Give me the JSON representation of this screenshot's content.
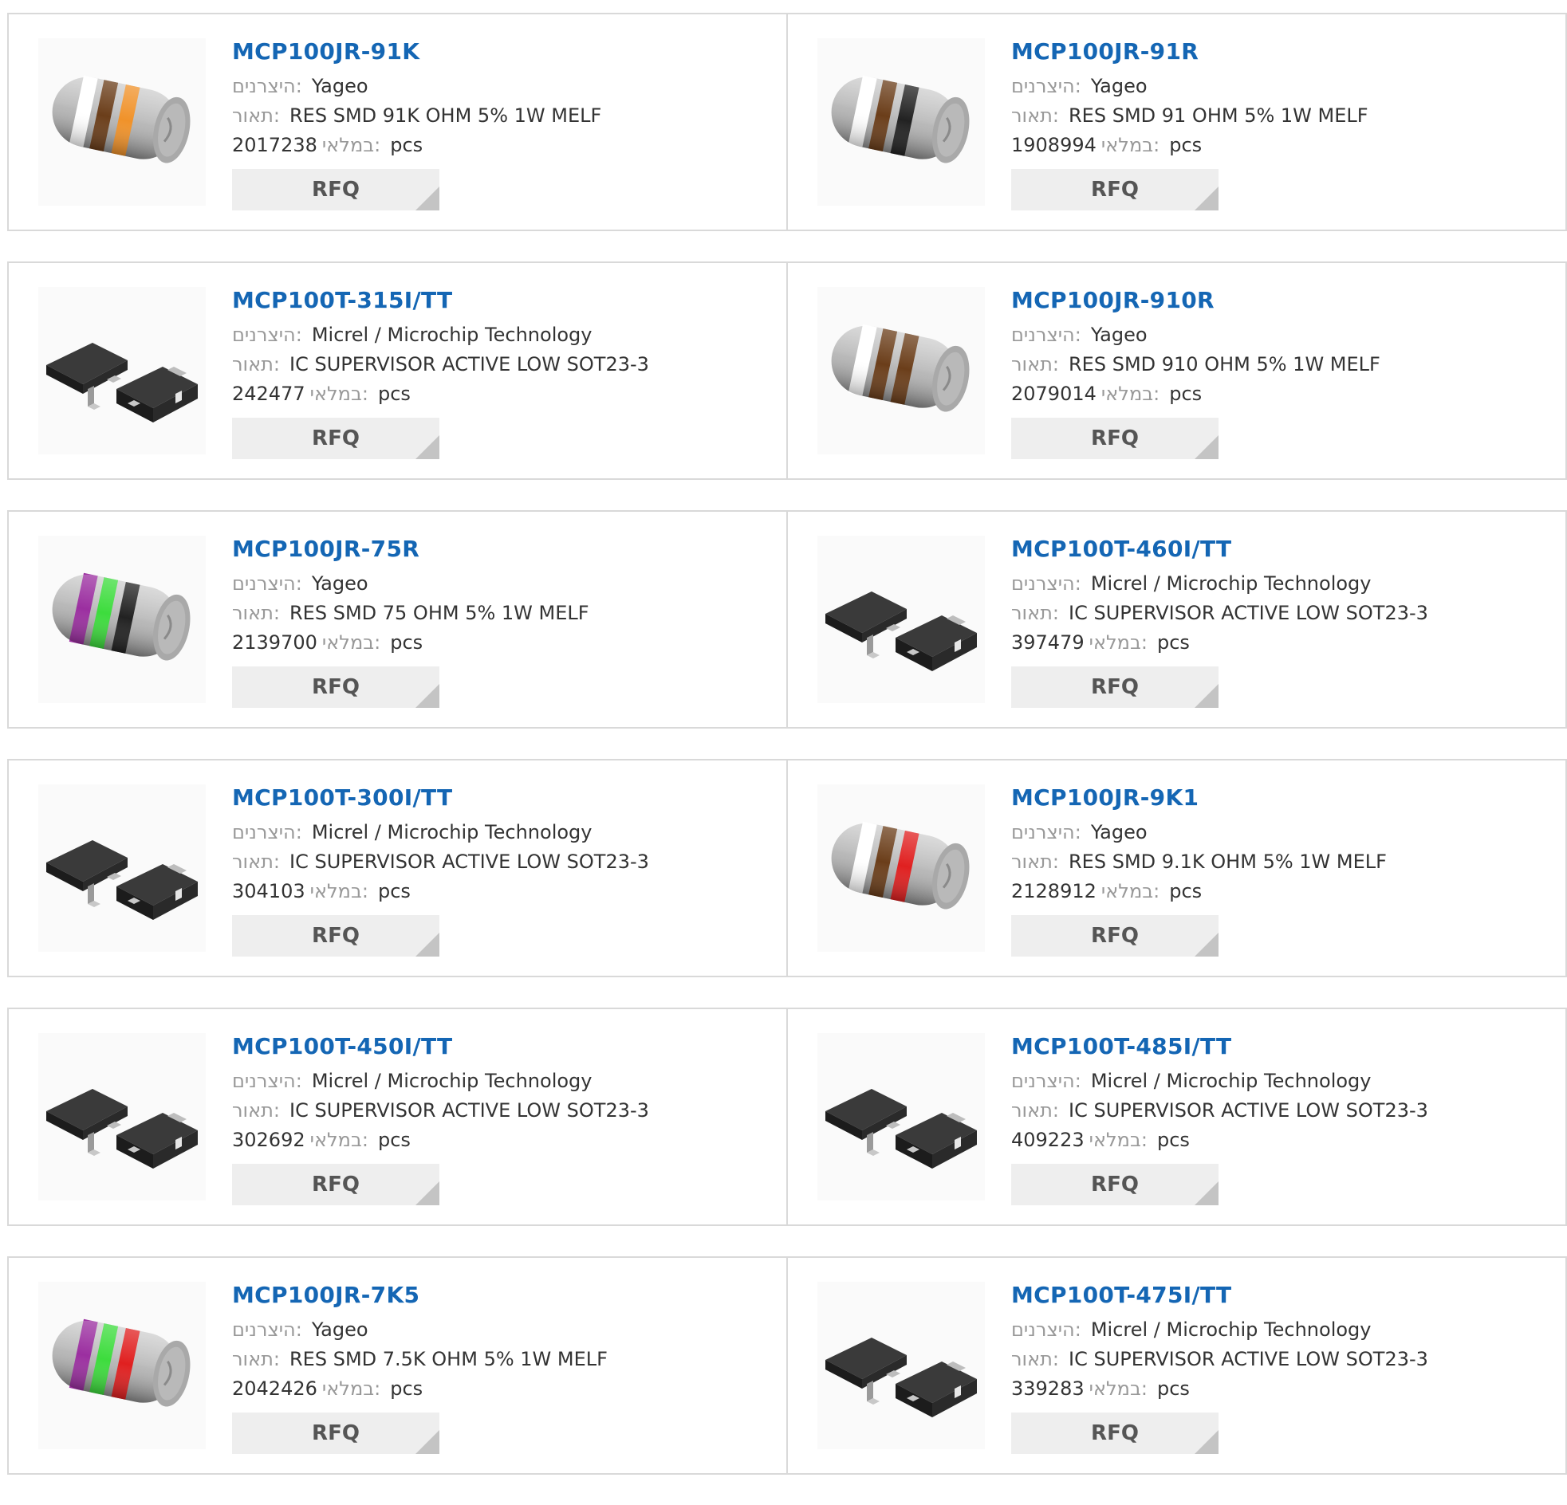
{
  "labels": {
    "manufacturer": "היצרנים:",
    "description": "תאור:",
    "stock": "במלאי:",
    "unit": "pcs",
    "rfq": "RFQ"
  },
  "rows": [
    [
      {
        "part": "MCP100JR-91K",
        "manufacturer": "Yageo",
        "description": "RES SMD 91K OHM 5% 1W MELF",
        "stock": "2017238",
        "image": {
          "kind": "resistor-icon",
          "bands": [
            "#ffffff",
            "#6b3e1a",
            "#f0922a"
          ]
        }
      },
      {
        "part": "MCP100JR-91R",
        "manufacturer": "Yageo",
        "description": "RES SMD 91 OHM 5% 1W MELF",
        "stock": "1908994",
        "image": {
          "kind": "resistor-icon",
          "bands": [
            "#ffffff",
            "#6b3e1a",
            "#222222"
          ]
        }
      }
    ],
    [
      {
        "part": "MCP100T-315I/TT",
        "manufacturer": "Micrel / Microchip Technology",
        "description": "IC SUPERVISOR ACTIVE LOW SOT23-3",
        "stock": "242477",
        "image": {
          "kind": "sot23-chip-icon"
        }
      },
      {
        "part": "MCP100JR-910R",
        "manufacturer": "Yageo",
        "description": "RES SMD 910 OHM 5% 1W MELF",
        "stock": "2079014",
        "image": {
          "kind": "resistor-icon",
          "bands": [
            "#ffffff",
            "#6b3e1a",
            "#6b3e1a"
          ]
        }
      }
    ],
    [
      {
        "part": "MCP100JR-75R",
        "manufacturer": "Yageo",
        "description": "RES SMD 75 OHM 5% 1W MELF",
        "stock": "2139700",
        "image": {
          "kind": "resistor-icon",
          "bands": [
            "#9b2fa0",
            "#3ddc3d",
            "#222222"
          ]
        }
      },
      {
        "part": "MCP100T-460I/TT",
        "manufacturer": "Micrel / Microchip Technology",
        "description": "IC SUPERVISOR ACTIVE LOW SOT23-3",
        "stock": "397479",
        "image": {
          "kind": "sot23-chip-icon"
        }
      }
    ],
    [
      {
        "part": "MCP100T-300I/TT",
        "manufacturer": "Micrel / Microchip Technology",
        "description": "IC SUPERVISOR ACTIVE LOW SOT23-3",
        "stock": "304103",
        "image": {
          "kind": "sot23-chip-icon"
        }
      },
      {
        "part": "MCP100JR-9K1",
        "manufacturer": "Yageo",
        "description": "RES SMD 9.1K OHM 5% 1W MELF",
        "stock": "2128912",
        "image": {
          "kind": "resistor-icon",
          "bands": [
            "#ffffff",
            "#6b3e1a",
            "#e02020"
          ]
        }
      }
    ],
    [
      {
        "part": "MCP100T-450I/TT",
        "manufacturer": "Micrel / Microchip Technology",
        "description": "IC SUPERVISOR ACTIVE LOW SOT23-3",
        "stock": "302692",
        "image": {
          "kind": "sot23-chip-icon"
        }
      },
      {
        "part": "MCP100T-485I/TT",
        "manufacturer": "Micrel / Microchip Technology",
        "description": "IC SUPERVISOR ACTIVE LOW SOT23-3",
        "stock": "409223",
        "image": {
          "kind": "sot23-chip-icon"
        }
      }
    ],
    [
      {
        "part": "MCP100JR-7K5",
        "manufacturer": "Yageo",
        "description": "RES SMD 7.5K OHM 5% 1W MELF",
        "stock": "2042426",
        "image": {
          "kind": "resistor-icon",
          "bands": [
            "#9b2fa0",
            "#3ddc3d",
            "#e02020"
          ]
        }
      },
      {
        "part": "MCP100T-475I/TT",
        "manufacturer": "Micrel / Microchip Technology",
        "description": "IC SUPERVISOR ACTIVE LOW SOT23-3",
        "stock": "339283",
        "image": {
          "kind": "sot23-chip-icon"
        }
      }
    ]
  ],
  "colors": {
    "part_link": "#1466b4",
    "label": "#999999",
    "text": "#333333",
    "rfq_bg": "#eeeeee",
    "border": "#d9d9d9"
  }
}
